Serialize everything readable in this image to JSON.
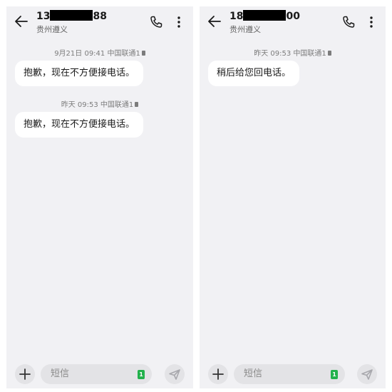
{
  "left": {
    "header": {
      "number_prefix": "13",
      "number_suffix": "88",
      "location": "贵州遵义"
    },
    "messages": [
      {
        "meta": "9月21日 09:41 中国联通1",
        "text": "抱歉，现在不方便接电话。"
      },
      {
        "meta": "昨天 09:53 中国联通1",
        "text": "抱歉，现在不方便接电话。"
      }
    ],
    "composer": {
      "placeholder": "短信",
      "sim_label": "1"
    }
  },
  "right": {
    "header": {
      "number_prefix": "18",
      "number_suffix": "00",
      "location": "贵州遵义"
    },
    "messages": [
      {
        "meta": "昨天 09:53 中国联通1",
        "text": "稍后给您回电话。"
      }
    ],
    "composer": {
      "placeholder": "短信",
      "sim_label": "1"
    }
  },
  "colors": {
    "screen_bg": "#f1f1f4",
    "bubble": "#ffffff",
    "sim_badge": "#22b14c",
    "redaction": "#000000"
  },
  "icons": [
    "back-arrow-icon",
    "phone-call-icon",
    "more-vertical-icon",
    "plus-icon",
    "send-icon",
    "sim-card-icon"
  ]
}
